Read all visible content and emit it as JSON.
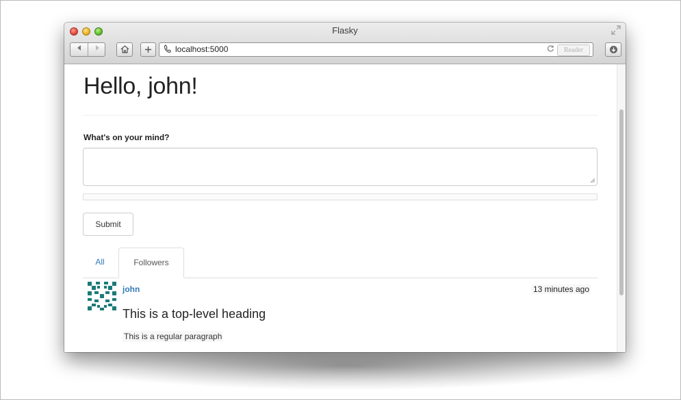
{
  "browser": {
    "window_title": "Flasky",
    "url": "localhost:5000",
    "reader_label": "Reader",
    "toolbar": {
      "back_icon": "back-arrow",
      "forward_icon": "forward-arrow",
      "home_icon": "home",
      "new_tab_icon": "plus",
      "address_icon": "phone",
      "reload_icon": "reload",
      "download_icon": "download"
    }
  },
  "page": {
    "heading": "Hello, john!",
    "form": {
      "label": "What's on your mind?",
      "textarea_value": "",
      "submit_label": "Submit"
    },
    "tabs": [
      {
        "label": "All",
        "active": false
      },
      {
        "label": "Followers",
        "active": true
      }
    ],
    "posts": [
      {
        "author": "john",
        "timestamp": "13 minutes ago",
        "heading": "This is a top-level heading",
        "paragraph": "This is a regular paragraph"
      }
    ]
  },
  "colors": {
    "link": "#337ab7",
    "avatar": "#1b7b78"
  }
}
